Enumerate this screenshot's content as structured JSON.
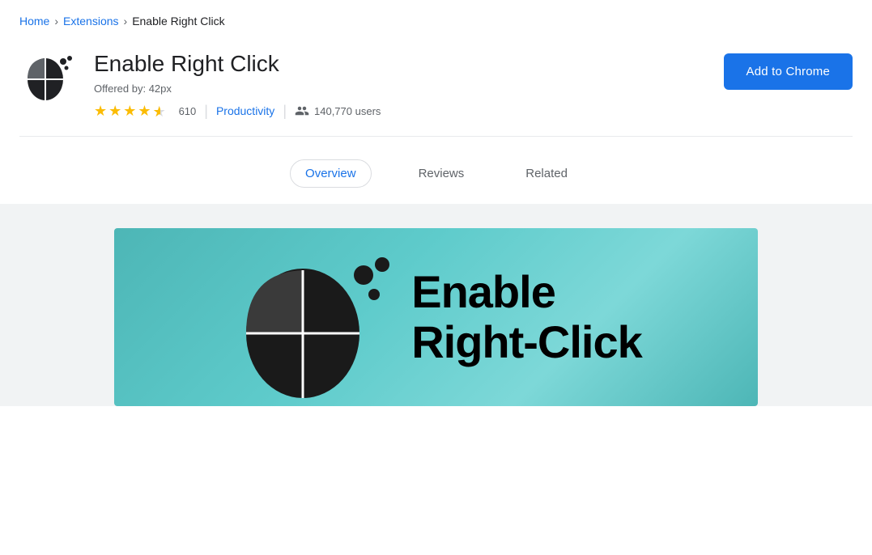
{
  "breadcrumb": {
    "home": "Home",
    "extensions": "Extensions",
    "current": "Enable Right Click"
  },
  "extension": {
    "title": "Enable Right Click",
    "offered_by_label": "Offered by:",
    "offered_by_name": "42px",
    "rating_value": 4.5,
    "rating_count": "610",
    "category": "Productivity",
    "users": "140,770 users"
  },
  "button": {
    "add_to_chrome": "Add to Chrome"
  },
  "tabs": [
    {
      "id": "overview",
      "label": "Overview",
      "active": true
    },
    {
      "id": "reviews",
      "label": "Reviews",
      "active": false
    },
    {
      "id": "related",
      "label": "Related",
      "active": false
    }
  ],
  "hero": {
    "title_line1": "Enable",
    "title_line2": "Right-Click"
  },
  "icons": {
    "home_color": "#1a73e8",
    "extensions_color": "#1a73e8",
    "star_color": "#fbbc04",
    "star_empty_color": "#dadce0"
  }
}
